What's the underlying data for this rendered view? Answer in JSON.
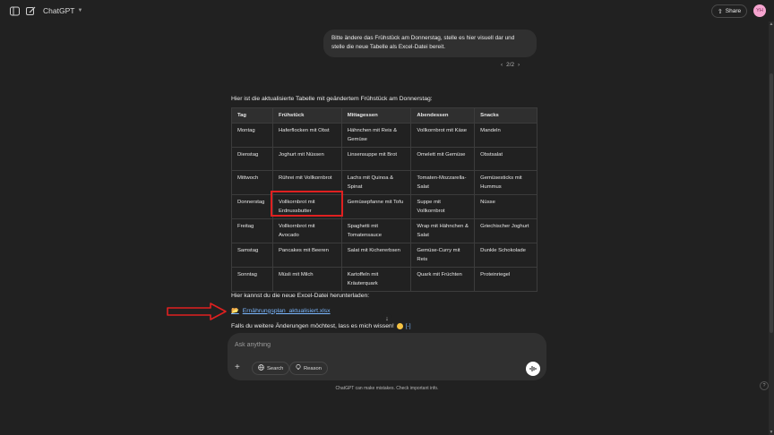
{
  "header": {
    "model_name": "ChatGPT",
    "share_label": "Share",
    "avatar_initials": "YH"
  },
  "conversation": {
    "user_message": "Bitte ändere das Frühstück am Donnerstag, stelle es hier visuell dar und stelle die neue Tabelle als Excel-Datei bereit.",
    "pager": "2/2",
    "assistant_intro": "Hier ist die aktualisierte Tabelle mit geändertem Frühstück am Donnerstag:",
    "table": {
      "headers": [
        "Tag",
        "Frühstück",
        "Mittagessen",
        "Abendessen",
        "Snacks"
      ],
      "rows": [
        [
          "Montag",
          "Haferflocken mit Obst",
          "Hähnchen mit Reis & Gemüse",
          "Vollkornbrot mit Käse",
          "Mandeln"
        ],
        [
          "Dienstag",
          "Joghurt mit Nüssen",
          "Linsensuppe mit Brot",
          "Omelett mit Gemüse",
          "Obstsalat"
        ],
        [
          "Mittwoch",
          "Rührei mit Vollkornbrot",
          "Lachs mit Quinoa & Spinat",
          "Tomaten-Mozzarella-Salat",
          "Gemüsesticks mit Hummus"
        ],
        [
          "Donnerstag",
          "Vollkornbrot mit Erdnussbutter",
          "Gemüsepfanne mit Tofu",
          "Suppe mit Vollkornbrot",
          "Nüsse"
        ],
        [
          "Freitag",
          "Vollkornbrot mit Avocado",
          "Spaghetti mit Tomatensauce",
          "Wrap mit Hähnchen & Salat",
          "Griechischer Joghurt"
        ],
        [
          "Samstag",
          "Pancakes mit Beeren",
          "Salat mit Kichererbsen",
          "Gemüse-Curry mit Reis",
          "Dunkle Schokolade"
        ],
        [
          "Sonntag",
          "Müsli mit Milch",
          "Kartoffeln mit Kräuterquark",
          "Quark mit Früchten",
          "Proteinriegel"
        ]
      ]
    },
    "download_label": "Hier kannst du die neue Excel-Datei herunterladen:",
    "file_name": "Ernährungsplan_aktualisiert.xlsx",
    "closing": "Falls du weitere Änderungen möchtest, lass es mich wissen!"
  },
  "composer": {
    "placeholder": "Ask anything",
    "search_label": "Search",
    "reason_label": "Reason"
  },
  "footer": {
    "disclaimer": "ChatGPT can make mistakes. Check important info.",
    "help": "?"
  },
  "icons": {
    "sidebar_toggle": "sidebar-icon",
    "new_chat": "edit-icon",
    "folder": "folder-icon",
    "voice": "waveform-icon"
  },
  "colors": {
    "background": "#212121",
    "link": "#7ab7ff",
    "highlight_box": "#e02020",
    "arrow": "#e02020",
    "avatar": "#f5a4cf"
  }
}
